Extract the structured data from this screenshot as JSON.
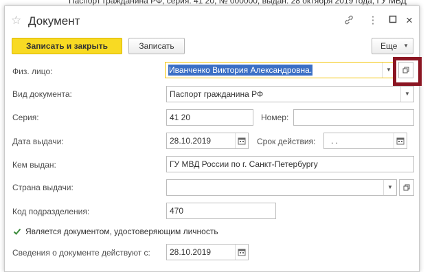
{
  "background_text": "Паспорт гражданина РФ, серия: 41 20, № 000000, выдан: 28 октября 2019 года, ГУ МВД",
  "window": {
    "title": "Документ"
  },
  "toolbar": {
    "save_close_label": "Записать и закрыть",
    "save_label": "Записать",
    "more_label": "Еще"
  },
  "form": {
    "person_label": "Физ. лицо:",
    "person_value": "Иванченко Виктория Александровна.",
    "doc_type_label": "Вид документа:",
    "doc_type_value": "Паспорт гражданина РФ",
    "series_label": "Серия:",
    "series_value": "41 20",
    "number_label": "Номер:",
    "number_value": "",
    "issue_date_label": "Дата выдачи:",
    "issue_date_value": "28.10.2019",
    "expiry_label": "Срок действия:",
    "expiry_value": " .  .",
    "issued_by_label": "Кем выдан:",
    "issued_by_value": "ГУ МВД России по г. Санкт-Петербургу",
    "country_label": "Страна выдачи:",
    "country_value": "",
    "dept_code_label": "Код подразделения:",
    "dept_code_value": "470",
    "identity_checkbox_label": "Является документом, удостоверяющим личность",
    "identity_checked": true,
    "valid_from_label": "Сведения о документе действуют с:",
    "valid_from_value": "28.10.2019"
  },
  "colors": {
    "primary_button": "#f8da23",
    "highlight_frame": "#8b1522",
    "selection": "#3b6fc5"
  }
}
